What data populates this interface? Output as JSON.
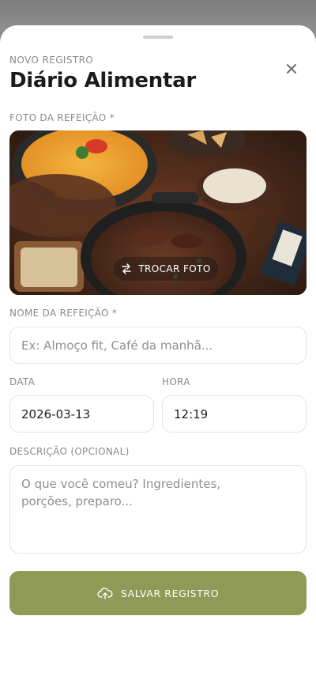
{
  "header": {
    "eyebrow": "NOVO REGISTRO",
    "title": "Diário Alimentar"
  },
  "photo": {
    "label": "FOTO DA REFEIÇÃO *",
    "swap_label": "TROCAR FOTO"
  },
  "meal_name": {
    "label": "NOME DA REFEIÇÃO *",
    "placeholder": "Ex: Almoço fit, Café da manhã..."
  },
  "date": {
    "label": "DATA",
    "value": "2026-03-13"
  },
  "time": {
    "label": "HORA",
    "value": "12:19"
  },
  "description": {
    "label": "DESCRIÇÃO (OPCIONAL)",
    "placeholder_line1": "O que você comeu? Ingredientes,",
    "placeholder_line2": "porções, preparo..."
  },
  "save_button": {
    "label": "SALVAR REGISTRO"
  },
  "icons": {
    "close": "close-icon",
    "swap": "swap-arrows-icon",
    "upload": "cloud-upload-icon"
  },
  "colors": {
    "accent": "#8e9a55",
    "text_primary": "#1b1b1b",
    "text_muted": "#8a8a8a",
    "border": "#e4e4e4"
  }
}
